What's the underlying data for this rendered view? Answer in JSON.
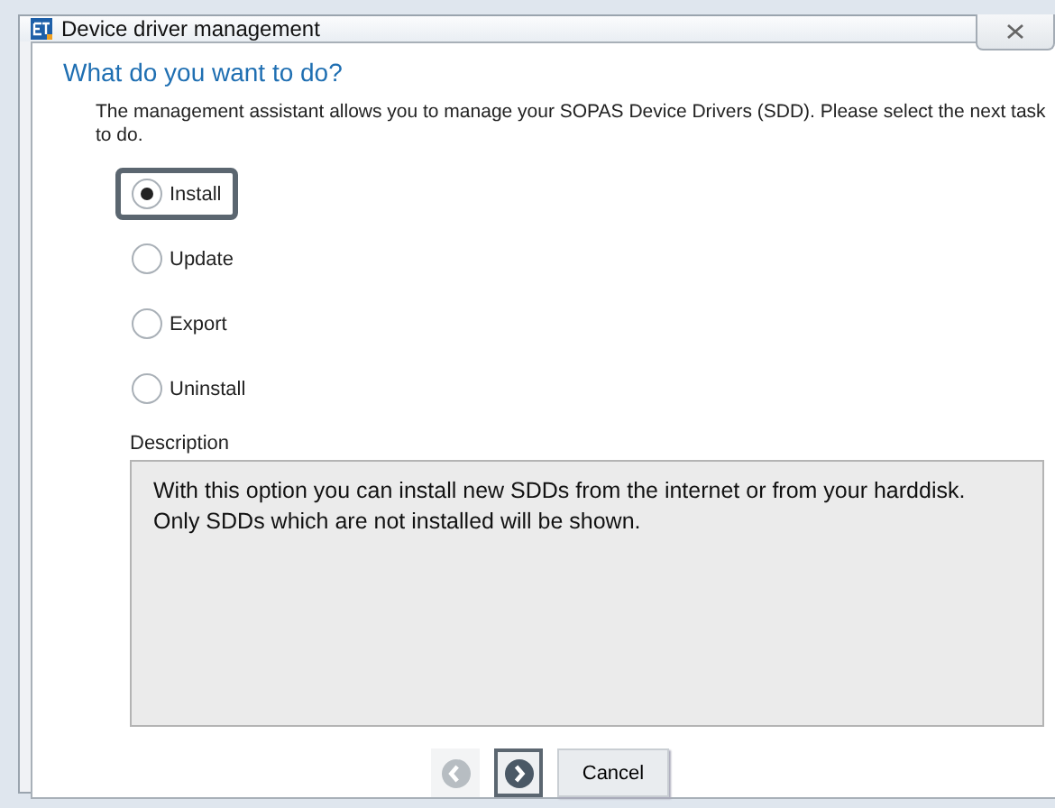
{
  "window": {
    "title": "Device driver management"
  },
  "heading": "What do you want to do?",
  "intro": "The management assistant allows you to manage your SOPAS Device Drivers (SDD). Please select the next task to do.",
  "options": [
    {
      "label": "Install",
      "selected": true
    },
    {
      "label": "Update",
      "selected": false
    },
    {
      "label": "Export",
      "selected": false
    },
    {
      "label": "Uninstall",
      "selected": false
    }
  ],
  "description": {
    "label": "Description",
    "text": "With this option you can install new SDDs from the internet or from your harddisk. Only SDDs which are not installed will be shown."
  },
  "navigation": [
    {
      "kind": "back",
      "disabled": true
    },
    {
      "kind": "next",
      "disabled": false
    }
  ],
  "buttons": [
    "Cancel"
  ]
}
